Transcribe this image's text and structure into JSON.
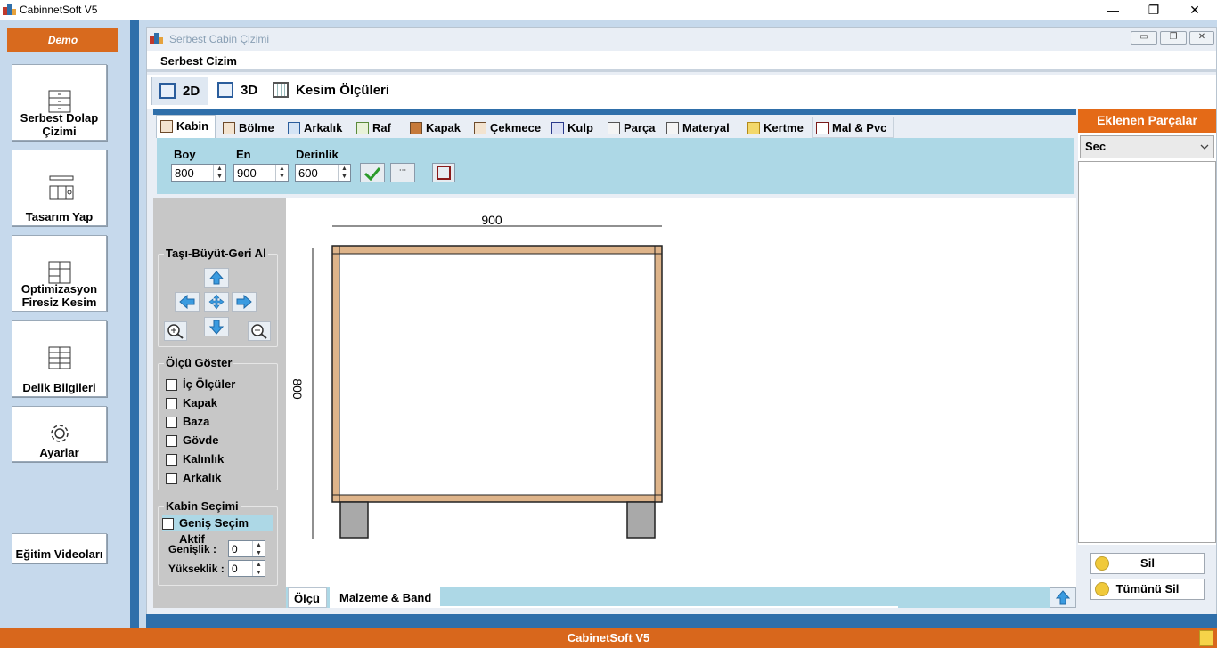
{
  "window": {
    "title": "CabinnetSoft V5",
    "minimize": "—",
    "maximize": "❐",
    "close": "✕"
  },
  "sidebar": {
    "demo_label": "Demo",
    "items": [
      {
        "label": "Serbest Dolap Çizimi",
        "icon": "drawer-cabinet-icon"
      },
      {
        "label": "Tasarım Yap",
        "icon": "kitchen-design-icon"
      },
      {
        "label": "Optimizasyon Firesiz Kesim",
        "icon": "cut-layout-icon"
      },
      {
        "label": "Delik Bilgileri",
        "icon": "hole-grid-icon"
      },
      {
        "label": "Ayarlar",
        "icon": "gear-icon"
      },
      {
        "label": "Eğitim Videoları",
        "icon": ""
      }
    ]
  },
  "child_window": {
    "title": "Serbest Cabin Çizimi",
    "menu_label": "Serbest Cizim"
  },
  "view_tabs": [
    {
      "label": "2D"
    },
    {
      "label": "3D"
    },
    {
      "label": "Kesim Ölçüleri"
    }
  ],
  "sub_tabs": [
    {
      "label": "Kabin"
    },
    {
      "label": "Bölme"
    },
    {
      "label": "Arkalık"
    },
    {
      "label": "Raf"
    },
    {
      "label": "Kapak"
    },
    {
      "label": "Çekmece"
    },
    {
      "label": "Kulp"
    },
    {
      "label": "Parça"
    },
    {
      "label": "Materyal"
    },
    {
      "label": "Kertme"
    },
    {
      "label": "Mal & Pvc"
    }
  ],
  "params": {
    "boy_label": "Boy",
    "boy_value": "800",
    "en_label": "En",
    "en_value": "900",
    "derinlik_label": "Derinlik",
    "derinlik_value": "600",
    "dots_label": ":::"
  },
  "move_group": {
    "title": "Taşı-Büyüt-Geri Al"
  },
  "measure_group": {
    "title": "Ölçü Göster",
    "options": [
      {
        "label": "İç Ölçüler",
        "checked": false
      },
      {
        "label": "Kapak",
        "checked": false
      },
      {
        "label": "Baza",
        "checked": false
      },
      {
        "label": "Gövde",
        "checked": false
      },
      {
        "label": "Kalınlık",
        "checked": false
      },
      {
        "label": "Arkalık",
        "checked": false
      }
    ]
  },
  "select_group": {
    "title": "Kabin Seçimi",
    "wide_select_label": "Geniş Seçim Aktif",
    "width_label": "Genişlik :",
    "width_value": "0",
    "height_label": "Yükseklik :",
    "height_value": "0"
  },
  "drawing": {
    "width_dim": "900",
    "height_dim": "800",
    "frame_color": "#deb48a",
    "leg_color": "#a9a9a9"
  },
  "bottom_tabs": [
    {
      "label": "Ölçü"
    },
    {
      "label": "Malzeme & Band"
    }
  ],
  "right_panel": {
    "title": "Eklenen Parçalar",
    "select_value": "Sec",
    "delete_label": "Sil",
    "delete_all_label": "Tümünü Sil"
  },
  "footer": {
    "label": "CabinetSoft  V5"
  },
  "colors": {
    "accent_orange": "#d8671c",
    "accent_blue": "#2f6faa",
    "panel_lightblue": "#add8e6"
  }
}
